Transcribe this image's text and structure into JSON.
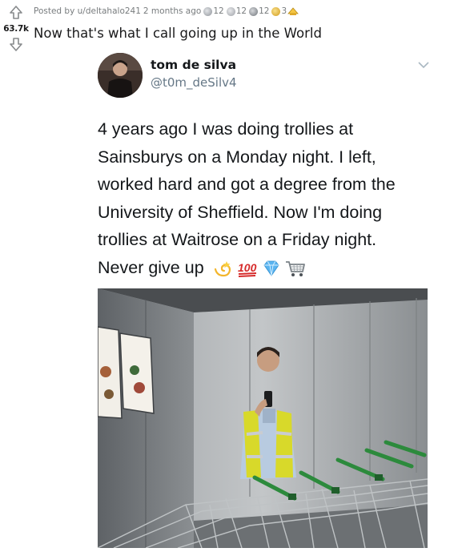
{
  "post": {
    "score": "63.7k",
    "posted_by": "Posted by u/deltahalo241",
    "age": "2 months ago",
    "awards": [
      {
        "icon": "silver-award-icon",
        "count": "12",
        "color": "#9aa0a6"
      },
      {
        "icon": "helpful-award-icon",
        "count": "12",
        "color": "#9aa0a6"
      },
      {
        "icon": "wholesome-award-icon",
        "count": "12",
        "color": "#8a8f96"
      },
      {
        "icon": "gold-award-icon",
        "count": "3",
        "color": "#e8b93b"
      }
    ],
    "title": "Now that's what I call going up in the World"
  },
  "tweet": {
    "display_name": "tom de silva",
    "handle": "@t0m_deSilv4",
    "lines": [
      "4 years ago I was doing trollies at",
      "Sainsburys on a Monday night. I left,",
      "worked hard and got a degree from the",
      "University of Sheffield. Now I'm doing",
      "trollies at Waitrose on a Friday night.",
      "Never give up"
    ],
    "emojis": [
      "dizzy-emoji",
      "hundred-emoji",
      "gem-emoji",
      "cart-emoji"
    ]
  },
  "colors": {
    "meta_gray": "#787c7e",
    "handle_gray": "#657786",
    "vest_yellow": "#d8d92a",
    "trolley_green": "#2c8a3c"
  }
}
